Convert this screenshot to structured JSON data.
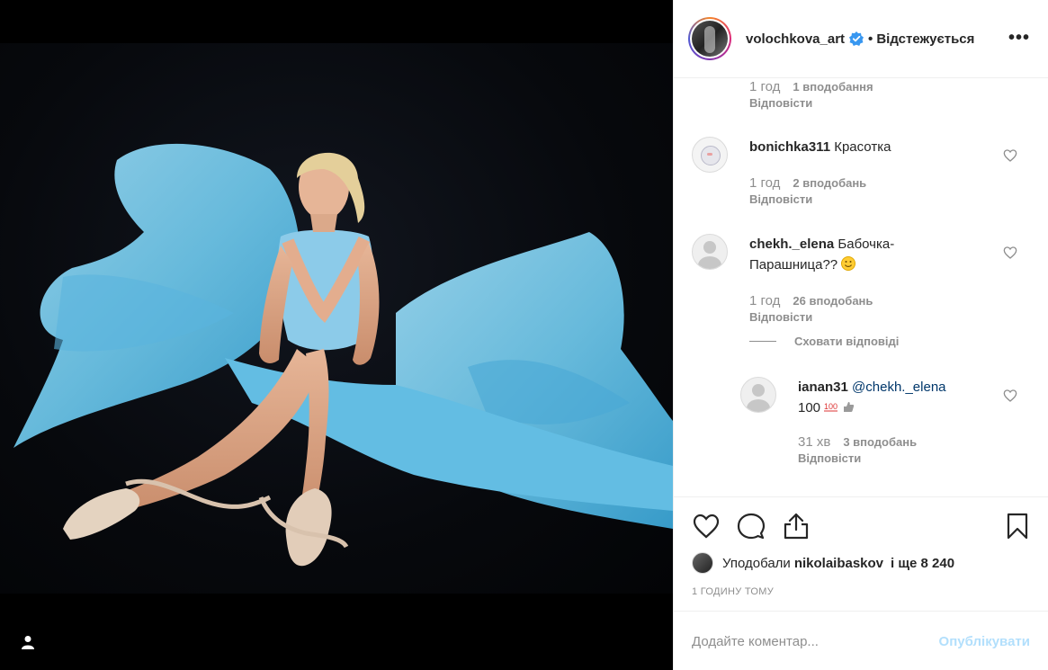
{
  "post": {
    "username": "volochkova_art",
    "follow_status": "Відстежується",
    "separator": "•",
    "more": "•••"
  },
  "comments": [
    {
      "time": "1 год",
      "likes": "1 вподобання",
      "reply": "Відповісти"
    },
    {
      "username": "bonichka311",
      "text": "Красотка",
      "time": "1 год",
      "likes": "2 вподобань",
      "reply": "Відповісти"
    },
    {
      "username": "chekh._elena",
      "text": "Бабочка-",
      "text2": "Парашница??",
      "time": "1 год",
      "likes": "26 вподобань",
      "reply": "Відповісти",
      "hide_replies": "Сховати відповіді"
    },
    {
      "username": "ianan31",
      "mention": "@chekh._elena",
      "text": "100",
      "time": "31 хв",
      "likes": "3 вподобань",
      "reply": "Відповісти"
    }
  ],
  "likes": {
    "prefix": "Уподобали",
    "user": "nikolaibaskov",
    "suffix": "і ще 8 240"
  },
  "time_ago": "1 ГОДИНУ ТОМУ",
  "comment_input": {
    "placeholder": "Додайте коментар..."
  },
  "publish_label": "Опублікувати",
  "colors": {
    "accent": "#0095f6",
    "publish_disabled": "#b2dffc",
    "fabric": "#6cc3e6",
    "verified": "#3897f0"
  }
}
